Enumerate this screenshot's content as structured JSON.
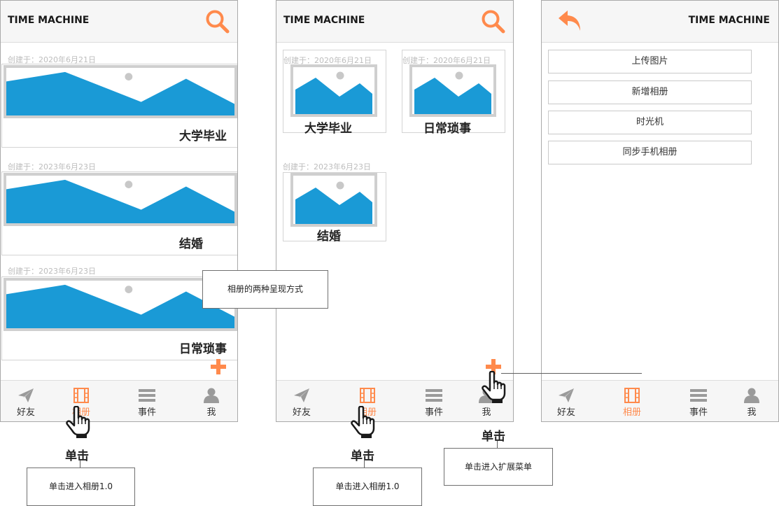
{
  "app": {
    "title": "TIME MACHINE"
  },
  "colors": {
    "accent": "#ff8a4c",
    "image_fill": "#1a9ad6",
    "frame": "#cfcfcf"
  },
  "screen1": {
    "albums": [
      {
        "created": "创建于：2020年6月21日",
        "title": "大学毕业"
      },
      {
        "created": "创建于：2023年6月23日",
        "title": "结婚"
      },
      {
        "created": "创建于：2023年6月23日",
        "title": "日常琐事"
      }
    ]
  },
  "screen2": {
    "albums": [
      {
        "created": "创建于：2020年6月21日",
        "title": "大学毕业"
      },
      {
        "created": "创建于：2020年6月21日",
        "title": "日常琐事"
      },
      {
        "created": "创建于：2023年6月23日",
        "title": "结婚"
      }
    ]
  },
  "screen3": {
    "menu": [
      "上传图片",
      "新增相册",
      "时光机",
      "同步手机相册"
    ]
  },
  "nav": {
    "friends": "好友",
    "album": "相册",
    "events": "事件",
    "me": "我"
  },
  "annotations": {
    "two_modes": "相册的两种呈现方式",
    "click": "单击",
    "enter_album": "单击进入相册1.0",
    "enter_menu": "单击进入扩展菜单"
  },
  "icons": [
    "search-icon",
    "back-arrow-icon",
    "plus-icon",
    "paper-plane-icon",
    "film-icon",
    "list-icon",
    "person-icon",
    "hand-pointer-icon"
  ]
}
